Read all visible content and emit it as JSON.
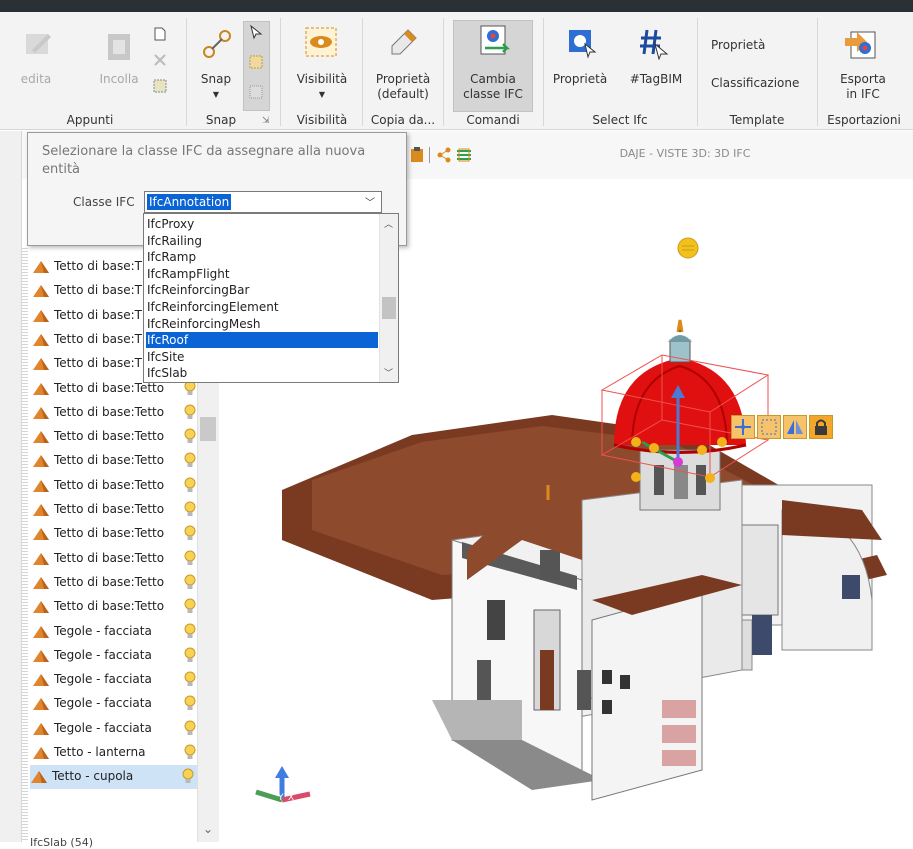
{
  "ribbon": {
    "groups": [
      {
        "name": "Appunti",
        "buttons": [
          {
            "label": "edita",
            "enabled": false
          },
          {
            "label": "Incolla",
            "enabled": false
          }
        ]
      },
      {
        "name": "Snap",
        "buttons": [
          {
            "label": "Snap"
          }
        ]
      },
      {
        "name": "Visibilità",
        "buttons": [
          {
            "label": "Visibilità"
          }
        ]
      },
      {
        "name": "Copia da...",
        "buttons": [
          {
            "label_line1": "Proprietà",
            "label_line2": "(default)"
          }
        ]
      },
      {
        "name": "Comandi",
        "buttons": [
          {
            "label_line1": "Cambia",
            "label_line2": "classe IFC",
            "pressed": true
          }
        ]
      },
      {
        "name": "Select Ifc",
        "buttons": [
          {
            "label": "Proprietà"
          },
          {
            "label": "#TagBIM"
          }
        ]
      },
      {
        "name": "Template",
        "buttons": [
          {
            "label": "Proprietà"
          },
          {
            "label": "Classificazione"
          }
        ]
      },
      {
        "name": "Esportazioni",
        "buttons": [
          {
            "label_line1": "Esporta",
            "label_line2": "in IFC"
          }
        ]
      }
    ]
  },
  "view_title": "DAJE -  VISTE 3D: 3D IFC",
  "popup": {
    "message": "Selezionare la classe IFC da assegnare alla nuova entità",
    "field_label": "Classe IFC",
    "field_value": "IfcAnnotation",
    "options": [
      "IfcProxy",
      "IfcRailing",
      "IfcRamp",
      "IfcRampFlight",
      "IfcReinforcingBar",
      "IfcReinforcingElement",
      "IfcReinforcingMesh",
      "IfcRoof",
      "IfcSite",
      "IfcSlab"
    ],
    "highlighted_option": "IfcRoof"
  },
  "tree": {
    "items": [
      {
        "label": "Tetto di base:T"
      },
      {
        "label": "Tetto di base:T"
      },
      {
        "label": "Tetto di base:T"
      },
      {
        "label": "Tetto di base:T"
      },
      {
        "label": "Tetto di base:T"
      },
      {
        "label": "Tetto di base:Tetto"
      },
      {
        "label": "Tetto di base:Tetto"
      },
      {
        "label": "Tetto di base:Tetto"
      },
      {
        "label": "Tetto di base:Tetto"
      },
      {
        "label": "Tetto di base:Tetto"
      },
      {
        "label": "Tetto di base:Tetto"
      },
      {
        "label": "Tetto di base:Tetto"
      },
      {
        "label": "Tetto di base:Tetto"
      },
      {
        "label": "Tetto di base:Tetto"
      },
      {
        "label": "Tetto di base:Tetto"
      },
      {
        "label": "Tegole - facciata"
      },
      {
        "label": "Tegole - facciata"
      },
      {
        "label": "Tegole - facciata"
      },
      {
        "label": "Tegole - facciata"
      },
      {
        "label": "Tegole - facciata"
      },
      {
        "label": "Tetto - lanterna"
      },
      {
        "label": "Tetto - cupola",
        "selected": true
      }
    ],
    "cut_label": "IfcSlab (54)"
  },
  "colors": {
    "selection_blue": "#0a64d6",
    "dome_red": "#e01010",
    "roof_brown": "#7a3a22"
  }
}
